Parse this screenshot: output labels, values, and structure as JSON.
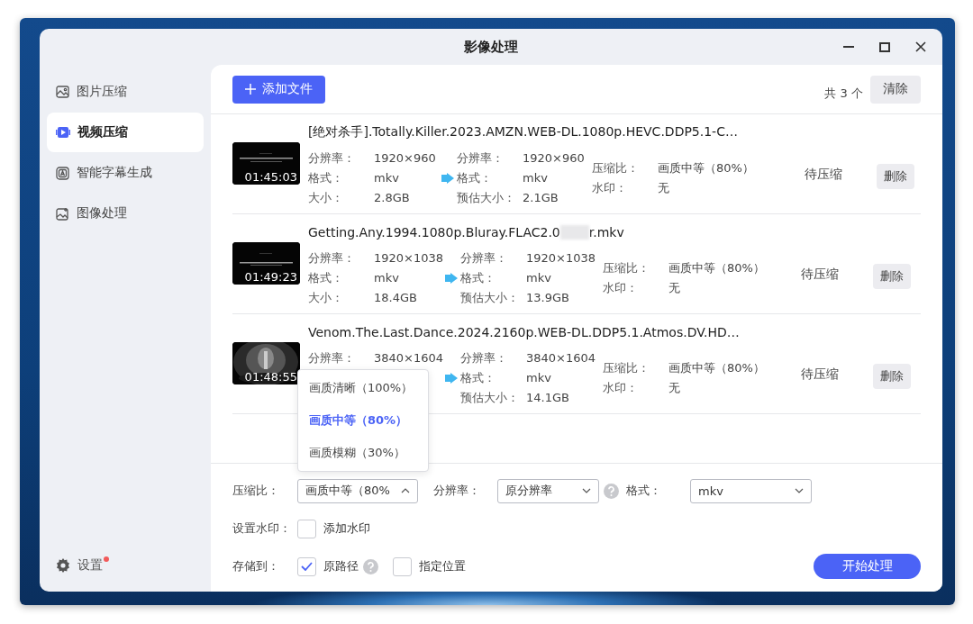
{
  "window": {
    "title": "影像处理"
  },
  "sidebar": {
    "items": [
      {
        "label": "图片压缩",
        "selected": false
      },
      {
        "label": "视频压缩",
        "selected": true
      },
      {
        "label": "智能字幕生成",
        "selected": false
      },
      {
        "label": "图像处理",
        "selected": false
      }
    ],
    "settings": {
      "label": "设置",
      "notification": true
    }
  },
  "toolbar": {
    "add_button": "添加文件",
    "count": "共 3 个",
    "clear_button": "清除"
  },
  "files": [
    {
      "name": "[绝对杀手].Totally.Killer.2023.AMZN.WEB-DL.1080p.HEVC.DDP5.1-C…",
      "duration": "01:45:03",
      "source": [
        {
          "label": "分辨率：",
          "value": "1920×960"
        },
        {
          "label": "格式：",
          "value": "mkv"
        },
        {
          "label": "大小：",
          "value": "2.8GB"
        }
      ],
      "target": [
        {
          "label": "分辨率：",
          "value": "1920×960"
        },
        {
          "label": "格式：",
          "value": "mkv"
        },
        {
          "label": "预估大小：",
          "value": "2.1GB"
        }
      ],
      "settings": [
        {
          "label": "压缩比：",
          "value": "画质中等（80%）"
        },
        {
          "label": "水印：",
          "value": "无"
        }
      ],
      "status": "待压缩",
      "delete_button": "删除"
    },
    {
      "name": "Getting.Any.1994.1080p.Bluray.FLAC2.0",
      "name_after_redaction": "r.mkv",
      "duration": "01:49:23",
      "source": [
        {
          "label": "分辨率：",
          "value": "1920×1038"
        },
        {
          "label": "格式：",
          "value": "mkv"
        },
        {
          "label": "大小：",
          "value": "18.4GB"
        }
      ],
      "target": [
        {
          "label": "分辨率：",
          "value": "1920×1038"
        },
        {
          "label": "格式：",
          "value": "mkv"
        },
        {
          "label": "预估大小：",
          "value": "13.9GB"
        }
      ],
      "settings": [
        {
          "label": "压缩比：",
          "value": "画质中等（80%）"
        },
        {
          "label": "水印：",
          "value": "无"
        }
      ],
      "status": "待压缩",
      "delete_button": "删除"
    },
    {
      "name": "Venom.The.Last.Dance.2024.2160p.WEB-DL.DDP5.1.Atmos.DV.HD…",
      "duration": "01:48:55",
      "source": [
        {
          "label": "分辨率：",
          "value": "3840×1604"
        }
      ],
      "target": [
        {
          "label": "分辨率：",
          "value": "3840×1604"
        },
        {
          "label": "格式：",
          "value": "mkv"
        },
        {
          "label": "预估大小：",
          "value": "14.1GB"
        }
      ],
      "settings": [
        {
          "label": "压缩比：",
          "value": "画质中等（80%）"
        },
        {
          "label": "水印：",
          "value": "无"
        }
      ],
      "status": "待压缩",
      "delete_button": "删除"
    }
  ],
  "form": {
    "compression": {
      "label": "压缩比：",
      "value": "画质中等（80%",
      "expanded": true,
      "options": [
        {
          "label": "画质清晰（100%）",
          "selected": false
        },
        {
          "label": "画质中等（80%）",
          "selected": true
        },
        {
          "label": "画质模糊（30%）",
          "selected": false
        }
      ]
    },
    "resolution": {
      "label": "分辨率：",
      "value": "原分辨率",
      "help": true
    },
    "format": {
      "label": "格式：",
      "value": "mkv"
    },
    "watermark": {
      "label": "设置水印：",
      "option": {
        "label": "添加水印",
        "checked": false
      }
    },
    "save_to": {
      "label": "存储到：",
      "options": [
        {
          "label": "原路径",
          "checked": true,
          "help": true
        },
        {
          "label": "指定位置",
          "checked": false
        }
      ]
    },
    "start_button": "开始处理"
  }
}
